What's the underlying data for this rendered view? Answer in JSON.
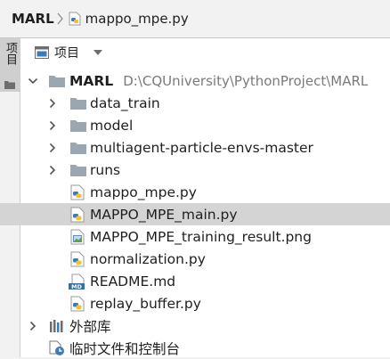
{
  "breadcrumb": {
    "project": "MARL",
    "file": "mappo_mpe.py"
  },
  "sidebar": {
    "tab_label": "项目"
  },
  "panel": {
    "title": "项目"
  },
  "tree": {
    "root": {
      "name": "MARL",
      "path": "D:\\CQUniversity\\PythonProject\\MARL"
    },
    "folders": [
      "data_train",
      "model",
      "multiagent-particle-envs-master",
      "runs"
    ],
    "files": [
      "mappo_mpe.py",
      "MAPPO_MPE_main.py",
      "MAPPO_MPE_training_result.png",
      "normalization.py",
      "README.md",
      "replay_buffer.py"
    ],
    "selected_file": "MAPPO_MPE_main.py",
    "md_badge": "MD",
    "external_libraries": "外部库",
    "scratches": "临时文件和控制台"
  }
}
